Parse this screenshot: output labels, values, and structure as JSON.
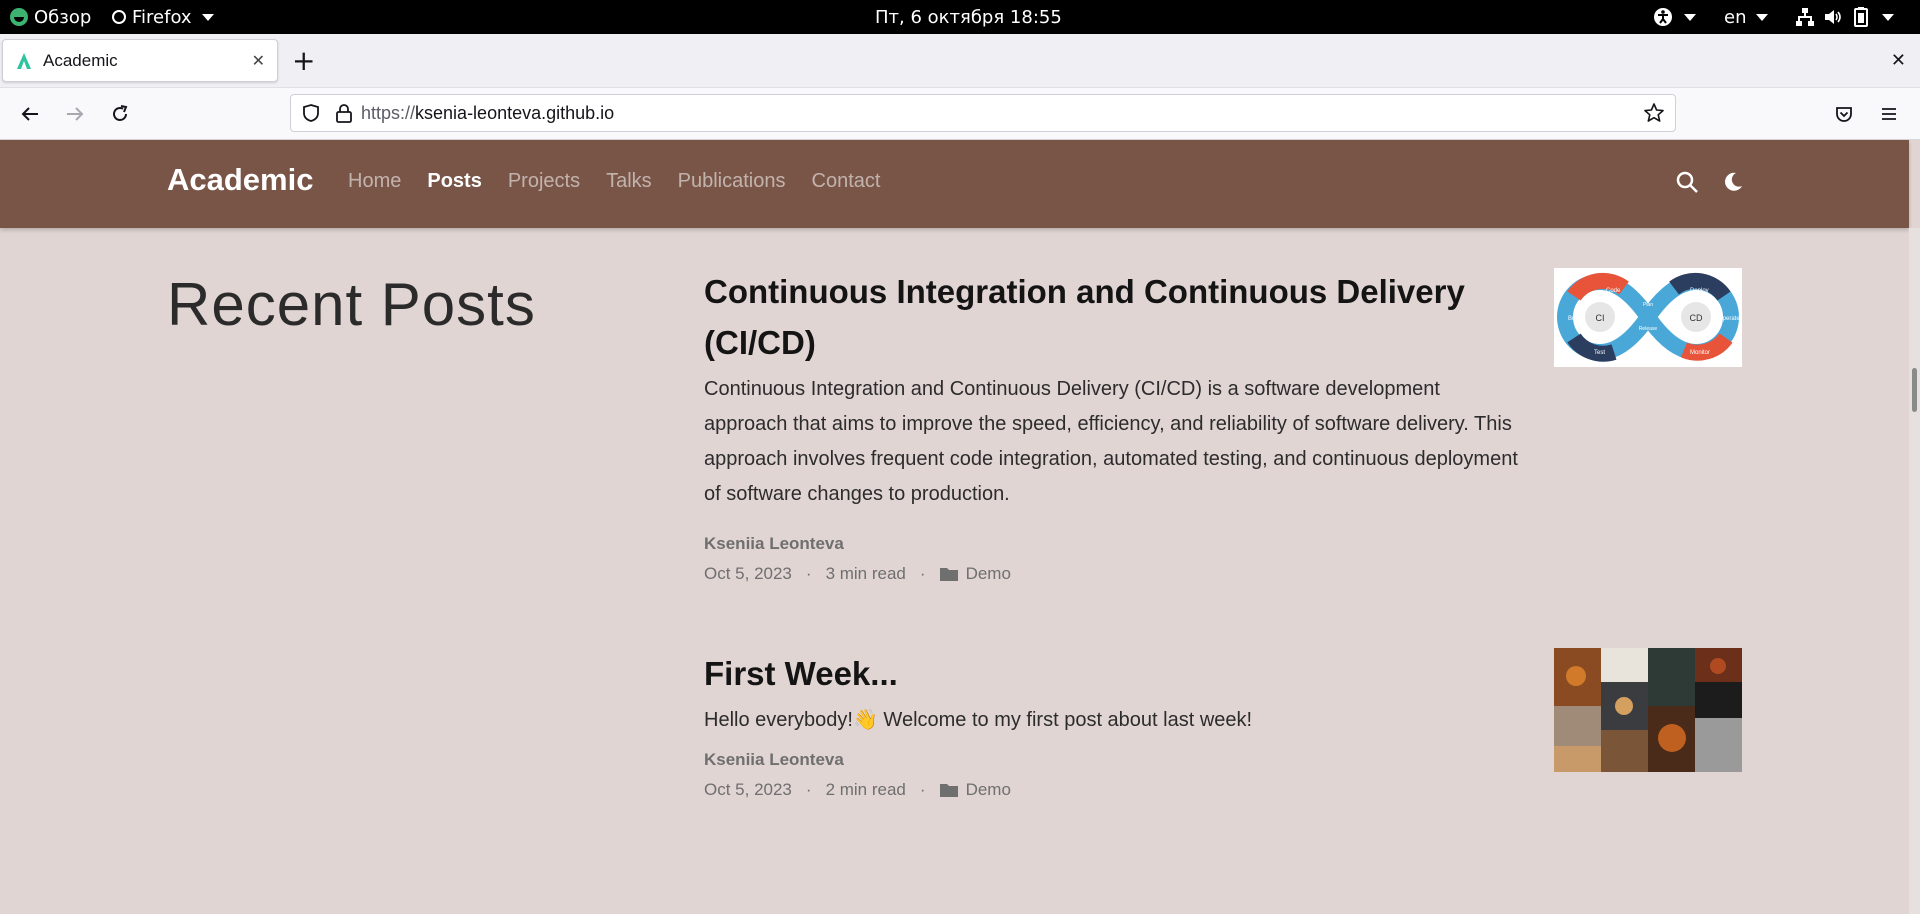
{
  "system_bar": {
    "overview_label": "Обзор",
    "app_label": "Firefox",
    "datetime": "Пт, 6 октября  18:55",
    "language": "en"
  },
  "browser": {
    "tab_title": "Academic",
    "url_scheme": "https://",
    "url_host": "ksenia-leonteva.github.io"
  },
  "site": {
    "brand": "Academic",
    "menu": [
      {
        "label": "Home",
        "active": false
      },
      {
        "label": "Posts",
        "active": true
      },
      {
        "label": "Projects",
        "active": false
      },
      {
        "label": "Talks",
        "active": false
      },
      {
        "label": "Publications",
        "active": false
      },
      {
        "label": "Contact",
        "active": false
      }
    ],
    "header_color": "#795548",
    "page_bg": "#e1d5d3"
  },
  "page": {
    "title": "Recent Posts"
  },
  "posts": [
    {
      "title": "Continuous Integration and Continuous Delivery (CI/CD)",
      "summary": "Continuous Integration and Continuous Delivery (CI/CD) is a software development approach that aims to improve the speed, efficiency, and reliability of software delivery. This approach involves frequent code integration, automated testing, and continuous deployment of software changes to production.",
      "author": "Kseniia Leonteva",
      "date": "Oct 5, 2023",
      "read_time": "3 min read",
      "category": "Demo",
      "thumb_labels": [
        "Code",
        "Build",
        "Test",
        "Plan",
        "CI",
        "Release",
        "Deploy",
        "Operate",
        "Monitor",
        "CD"
      ]
    },
    {
      "title": "First Week...",
      "summary": "Hello everybody!👋 Welcome to my first post about last week!",
      "author": "Kseniia Leonteva",
      "date": "Oct 5, 2023",
      "read_time": "2 min read",
      "category": "Demo"
    }
  ]
}
